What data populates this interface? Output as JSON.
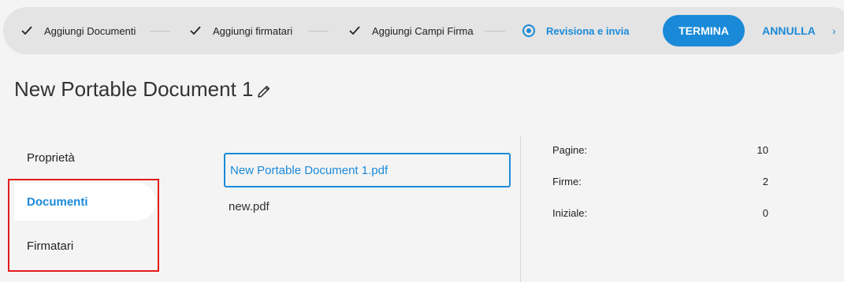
{
  "stepper": {
    "steps": [
      {
        "label": "Aggiungi Documenti",
        "status": "done",
        "icon": "check-icon"
      },
      {
        "label": "Aggiungi firmatari",
        "status": "done",
        "icon": "check-icon"
      },
      {
        "label": "Aggiungi Campi Firma",
        "status": "done",
        "icon": "check-icon"
      },
      {
        "label": "Revisiona e invia",
        "status": "active",
        "icon": "radio-icon"
      }
    ],
    "finish_label": "TERMINA",
    "cancel_label": "ANNULLA",
    "next_icon": "chevron-right-icon"
  },
  "page": {
    "title": "New Portable Document 1",
    "edit_icon": "pencil-icon"
  },
  "sidebar": {
    "items": [
      {
        "label": "Proprietà",
        "active": false
      },
      {
        "label": "Documenti",
        "active": true
      },
      {
        "label": "Firmatari",
        "active": false
      }
    ]
  },
  "documents": {
    "items": [
      {
        "name": "New Portable Document 1.pdf",
        "selected": true
      },
      {
        "name": "new.pdf",
        "selected": false
      }
    ]
  },
  "stats": [
    {
      "label": "Pagine:",
      "value": "10"
    },
    {
      "label": "Firme:",
      "value": "2"
    },
    {
      "label": "Iniziale:",
      "value": "0"
    }
  ],
  "colors": {
    "accent": "#1a8ad8",
    "highlight": "#e31b1b",
    "background": "#f4f4f4",
    "stepper_bg": "#e4e4e4"
  }
}
